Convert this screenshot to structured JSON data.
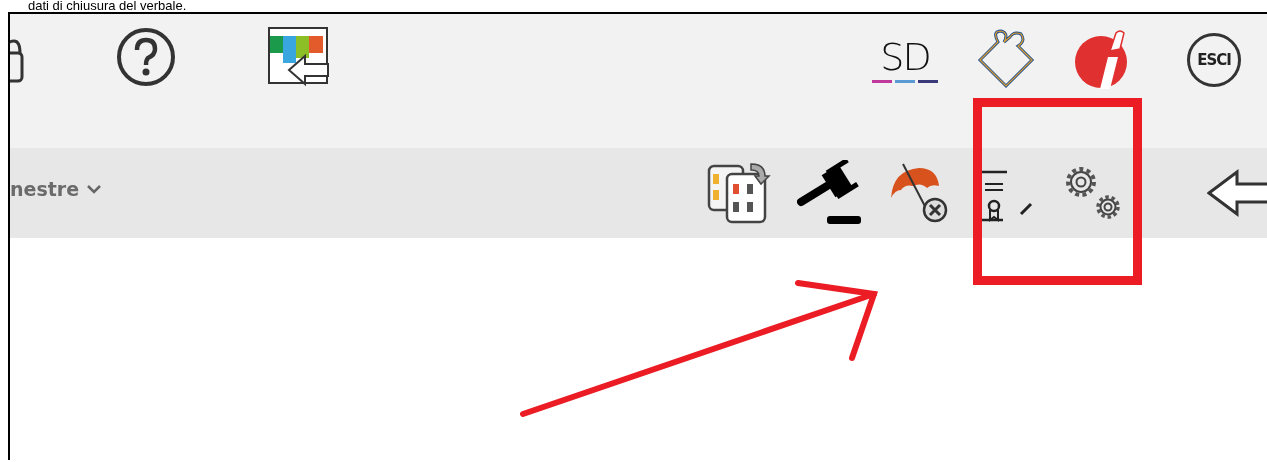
{
  "caption": "dati di chiusura del verbale.",
  "top_toolbar": {
    "left": [
      {
        "kind": "lock"
      },
      {
        "kind": "help"
      },
      {
        "kind": "columns"
      }
    ],
    "right": [
      {
        "kind": "logo",
        "text": "SD"
      },
      {
        "kind": "puzzle"
      },
      {
        "kind": "info"
      },
      {
        "kind": "exit",
        "text": "ESCI"
      }
    ]
  },
  "sub_toolbar": {
    "dropdown": {
      "label": "nestre"
    },
    "tools": [
      {
        "kind": "numbers"
      },
      {
        "kind": "gavel"
      },
      {
        "kind": "umbrella"
      },
      {
        "kind": "certificate"
      },
      {
        "kind": "gears"
      }
    ],
    "back_button": true
  },
  "annotations": {
    "highlight_box": true,
    "arrow": true
  }
}
